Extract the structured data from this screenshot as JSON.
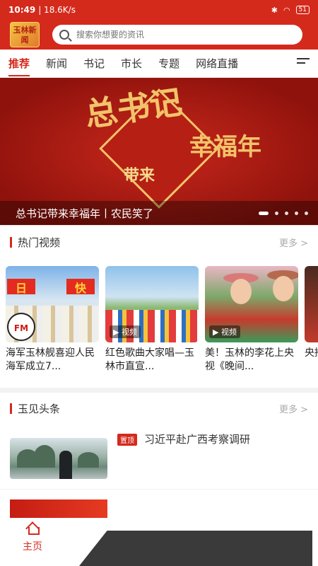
{
  "status": {
    "time": "10:49",
    "net": "| 18.6K/s",
    "battery": "51"
  },
  "search": {
    "placeholder": "搜索你想要的资讯"
  },
  "logo_text": "玉林新闻",
  "tabs": [
    "推荐",
    "新闻",
    "书记",
    "市长",
    "专题",
    "网络直播",
    "..."
  ],
  "banner": {
    "big": "总书记",
    "sub": "幸福年",
    "small": "带来",
    "caption": "总书记带来幸福年丨农民笑了"
  },
  "sections": {
    "hot_video": {
      "title": "热门视频",
      "more": "更多 >"
    },
    "yujian": {
      "title": "玉见头条",
      "more": "更多 >"
    }
  },
  "videos": [
    {
      "title": "海军玉林舰喜迎人民海军成立7...",
      "tag": "",
      "flag_left": "日",
      "flag_right": "快",
      "fm": "FM"
    },
    {
      "title": "红色歌曲大家唱—玉林市直宣...",
      "tag": "▶ 视频"
    },
    {
      "title": "美！玉林的李花上央视《晚间...",
      "tag": "▶ 视频"
    },
    {
      "title": "央播",
      "tag": ""
    }
  ],
  "news": [
    {
      "badge": "置顶",
      "title": "习近平赴广西考察调研"
    }
  ],
  "bottom_nav": {
    "home": "主页"
  },
  "colors": {
    "brand_red": "#d42a1c"
  }
}
